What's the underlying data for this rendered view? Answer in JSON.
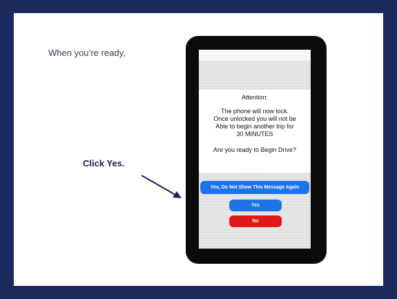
{
  "slide": {
    "intro_text": "When you’re ready,",
    "callout_text": "Click Yes."
  },
  "dialog": {
    "title": "Attention:",
    "body_lines": [
      "The phone will now lock.",
      "Once unlocked you will not be",
      "Able to begin another trip for",
      "30 MINUTES"
    ],
    "question": "Are you ready to Begin Drive?"
  },
  "buttons": {
    "dont_show_label": "Yes, Do Not Show This Message Again",
    "yes_label": "Yes",
    "no_label": "No"
  },
  "colors": {
    "background": "#1b2a5c",
    "callout_text": "#15234f",
    "button_blue": "#1e73e8",
    "button_red": "#e01818",
    "phone_frame": "#0b0b0b"
  },
  "icons": {
    "pointer_arrow": "arrow-right-down-icon"
  }
}
